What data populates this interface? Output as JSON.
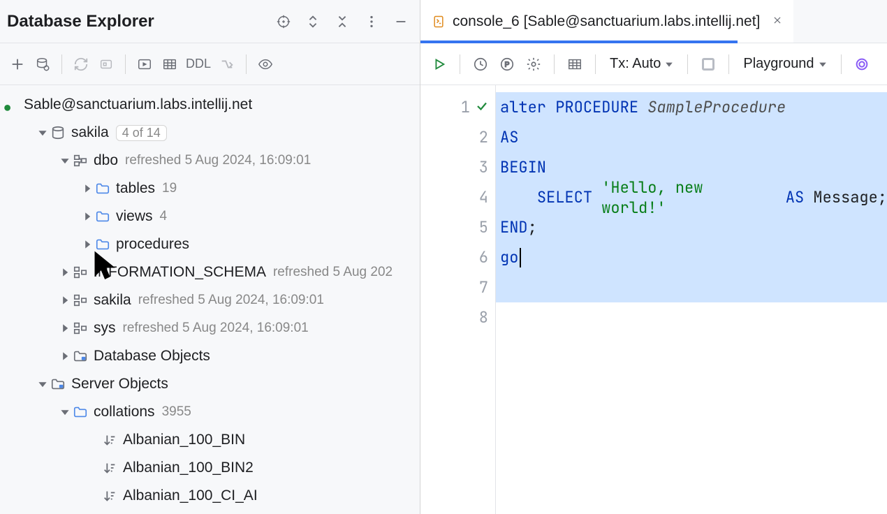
{
  "left": {
    "title": "Database Explorer",
    "title_icons": [
      "target-icon",
      "updown-icon",
      "collapse-icon",
      "more-icon",
      "minimize-icon"
    ],
    "toolbar": {
      "ddl_label": "DDL"
    },
    "connection": "Sable@sanctuarium.labs.intellij.net",
    "tree": {
      "sakila_db": {
        "name": "sakila",
        "badge": "4 of 14"
      },
      "dbo": {
        "name": "dbo",
        "refreshed": "refreshed 5 Aug 2024, 16:09:01"
      },
      "tables": {
        "name": "tables",
        "count": "19"
      },
      "views": {
        "name": "views",
        "count": "4"
      },
      "procedures": {
        "name": "procedures"
      },
      "info_schema": {
        "name": "INFORMATION_SCHEMA",
        "refreshed": "refreshed 5 Aug 202"
      },
      "sakila_schema": {
        "name": "sakila",
        "refreshed": "refreshed 5 Aug 2024, 16:09:01"
      },
      "sys": {
        "name": "sys",
        "refreshed": "refreshed 5 Aug 2024, 16:09:01"
      },
      "db_objects": {
        "name": "Database Objects"
      },
      "server_objects": {
        "name": "Server Objects"
      },
      "collations": {
        "name": "collations",
        "count": "3955"
      },
      "coll1": "Albanian_100_BIN",
      "coll2": "Albanian_100_BIN2",
      "coll3": "Albanian_100_CI_AI"
    }
  },
  "right": {
    "tab": {
      "title": "console_6 [Sable@sanctuarium.labs.intellij.net]"
    },
    "toolbar": {
      "tx_label": "Tx: Auto",
      "mode_label": "Playground"
    },
    "gutter": [
      "1",
      "2",
      "3",
      "4",
      "5",
      "6",
      "7",
      "8"
    ],
    "code": {
      "l1": {
        "kw1": "alter",
        "kw2": "PROCEDURE",
        "id": "SampleProcedure"
      },
      "l2": {
        "kw": "AS"
      },
      "l3": {
        "kw": "BEGIN"
      },
      "l4": {
        "kw1": "SELECT",
        "str": "'Hello, new world!'",
        "kw2": "AS",
        "plain": "Message;"
      },
      "l5": {
        "kw": "END",
        "plain": ";"
      },
      "l6": {
        "kw": "go"
      }
    }
  }
}
